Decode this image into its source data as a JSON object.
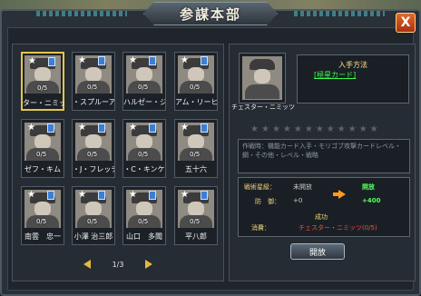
{
  "title": "参謀本部",
  "close_label": "X",
  "cards": [
    {
      "name": "ター・ニミッ",
      "count": "0/5",
      "selected": true
    },
    {
      "name": "・スプルーア",
      "count": "0/5"
    },
    {
      "name": "ハルゼー・ジ",
      "count": "0/5"
    },
    {
      "name": "アム・リーヒ",
      "count": "0/5"
    },
    {
      "name": "ゼフ・キム",
      "count": "0/5"
    },
    {
      "name": "・J・フレッチ",
      "count": "0/5"
    },
    {
      "name": "・C・キンケ",
      "count": "0/5"
    },
    {
      "name": "五十六",
      "count": "0/5"
    },
    {
      "name": "南雲　忠一",
      "count": "0/5"
    },
    {
      "name": "小澤 治三郎",
      "count": "0/5"
    },
    {
      "name": "山口　多聞",
      "count": "0/5"
    },
    {
      "name": "平八郎",
      "count": "0/5"
    }
  ],
  "pager": "1/3",
  "detail": {
    "name": "チェスター・ニミッツ",
    "acquire_title": "入手方法",
    "acquire_link": "[極星カード]",
    "description": "作戦時：機能カード入手・モリゴブ攻撃カードレベル・鋼・その他・レベル・戦略",
    "tactics_label": "戦術星級：",
    "tactics_before": "未開放",
    "tactics_after": "開放",
    "defense_label": "防　御：",
    "defense_before": "+0",
    "defense_after": "+400",
    "success_label": "成功",
    "cost_label": "消費：",
    "cost_value": "チェスター・ニミッツ(0/5)"
  },
  "develop_button": "開放"
}
